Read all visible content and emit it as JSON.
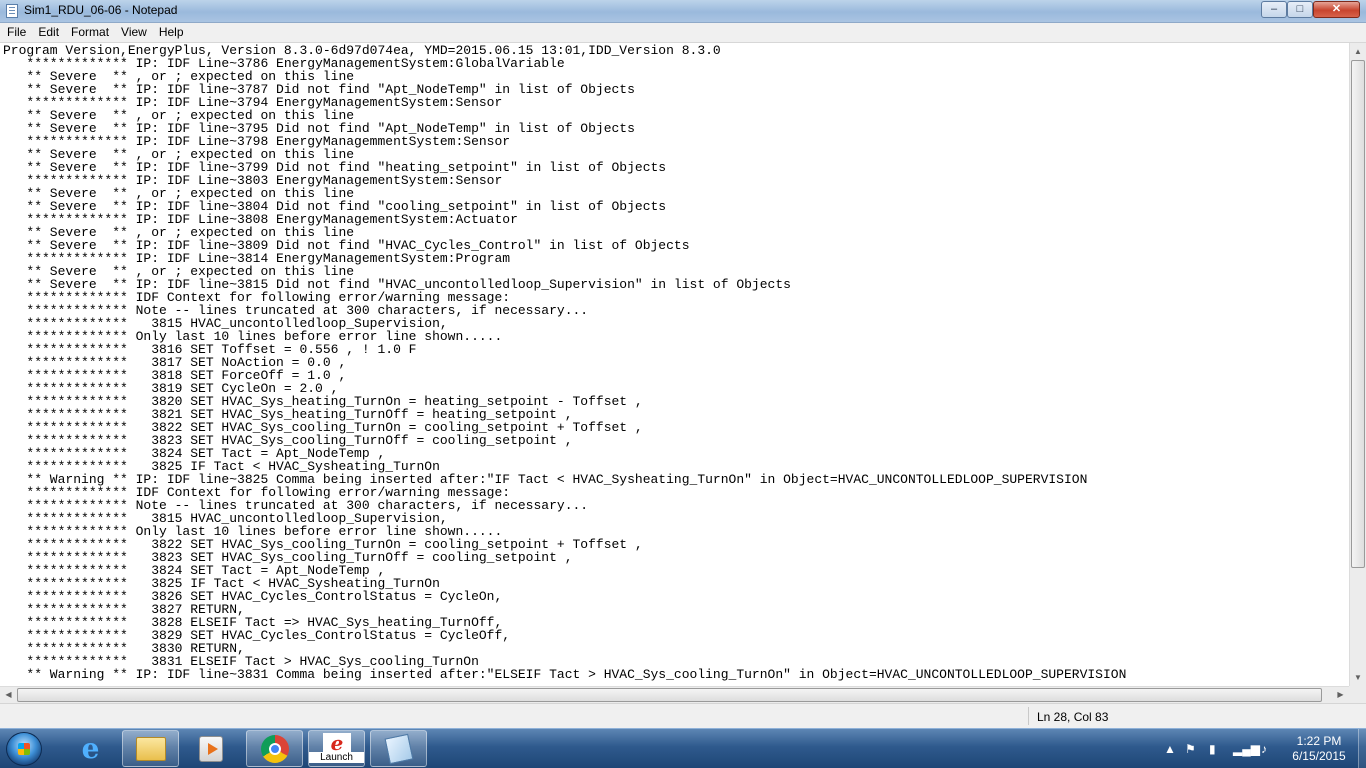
{
  "window": {
    "title": "Sim1_RDU_06-06 - Notepad"
  },
  "menu": [
    "File",
    "Edit",
    "Format",
    "View",
    "Help"
  ],
  "editor": {
    "lines": [
      "Program Version,EnergyPlus, Version 8.3.0-6d97d074ea, YMD=2015.06.15 13:01,IDD_Version 8.3.0",
      "   ************* IP: IDF Line~3786 EnergyManagementSystem:GlobalVariable",
      "   ** Severe  ** , or ; expected on this line",
      "   ** Severe  ** IP: IDF line~3787 Did not find \"Apt_NodeTemp\" in list of Objects",
      "   ************* IP: IDF Line~3794 EnergyManagementSystem:Sensor",
      "   ** Severe  ** , or ; expected on this line",
      "   ** Severe  ** IP: IDF line~3795 Did not find \"Apt_NodeTemp\" in list of Objects",
      "   ************* IP: IDF Line~3798 EnergyManagemmentSystem:Sensor",
      "   ** Severe  ** , or ; expected on this line",
      "   ** Severe  ** IP: IDF line~3799 Did not find \"heating_setpoint\" in list of Objects",
      "   ************* IP: IDF Line~3803 EnergyManagementSystem:Sensor",
      "   ** Severe  ** , or ; expected on this line",
      "   ** Severe  ** IP: IDF line~3804 Did not find \"cooling_setpoint\" in list of Objects",
      "   ************* IP: IDF Line~3808 EnergyManagementSystem:Actuator",
      "   ** Severe  ** , or ; expected on this line",
      "   ** Severe  ** IP: IDF line~3809 Did not find \"HVAC_Cycles_Control\" in list of Objects",
      "   ************* IP: IDF Line~3814 EnergyManagementSystem:Program",
      "   ** Severe  ** , or ; expected on this line",
      "   ** Severe  ** IP: IDF line~3815 Did not find \"HVAC_uncontolledloop_Supervision\" in list of Objects",
      "   ************* IDF Context for following error/warning message:",
      "   ************* Note -- lines truncated at 300 characters, if necessary...",
      "   *************   3815 HVAC_uncontolledloop_Supervision,",
      "   ************* Only last 10 lines before error line shown.....",
      "   *************   3816 SET Toffset = 0.556 , ! 1.0 F",
      "   *************   3817 SET NoAction = 0.0 ,",
      "   *************   3818 SET ForceOff = 1.0 ,",
      "   *************   3819 SET CycleOn = 2.0 ,",
      "   *************   3820 SET HVAC_Sys_heating_TurnOn = heating_setpoint - Toffset ,",
      "   *************   3821 SET HVAC_Sys_heating_TurnOff = heating_setpoint ,",
      "   *************   3822 SET HVAC_Sys_cooling_TurnOn = cooling_setpoint + Toffset ,",
      "   *************   3823 SET HVAC_Sys_cooling_TurnOff = cooling_setpoint ,",
      "   *************   3824 SET Tact = Apt_NodeTemp ,",
      "   *************   3825 IF Tact < HVAC_Sysheating_TurnOn",
      "   ** Warning ** IP: IDF line~3825 Comma being inserted after:\"IF Tact < HVAC_Sysheating_TurnOn\" in Object=HVAC_UNCONTOLLEDLOOP_SUPERVISION",
      "   ************* IDF Context for following error/warning message:",
      "   ************* Note -- lines truncated at 300 characters, if necessary...",
      "   *************   3815 HVAC_uncontolledloop_Supervision,",
      "   ************* Only last 10 lines before error line shown.....",
      "   *************   3822 SET HVAC_Sys_cooling_TurnOn = cooling_setpoint + Toffset ,",
      "   *************   3823 SET HVAC_Sys_cooling_TurnOff = cooling_setpoint ,",
      "   *************   3824 SET Tact = Apt_NodeTemp ,",
      "   *************   3825 IF Tact < HVAC_Sysheating_TurnOn",
      "   *************   3826 SET HVAC_Cycles_ControlStatus = CycleOn,",
      "   *************   3827 RETURN,",
      "   *************   3828 ELSEIF Tact => HVAC_Sys_heating_TurnOff,",
      "   *************   3829 SET HVAC_Cycles_ControlStatus = CycleOff,",
      "   *************   3830 RETURN,",
      "   *************   3831 ELSEIF Tact > HVAC_Sys_cooling_TurnOn",
      "   ** Warning ** IP: IDF line~3831 Comma being inserted after:\"ELSEIF Tact > HVAC_Sys_cooling_TurnOn\" in Object=HVAC_UNCONTOLLEDLOOP_SUPERVISION"
    ]
  },
  "status": {
    "position": "Ln 28, Col 83"
  },
  "taskbar": {
    "pinned": [
      {
        "name": "internet-explorer",
        "icon": "ie-icon"
      },
      {
        "name": "windows-explorer",
        "icon": "folder-icon"
      },
      {
        "name": "media-player",
        "icon": "media-player-icon"
      },
      {
        "name": "chrome",
        "icon": "chrome-icon"
      },
      {
        "name": "launch",
        "icon": "launch-icon",
        "label": "Launch"
      },
      {
        "name": "notepad",
        "icon": "notepad-icon"
      }
    ],
    "clock": {
      "time": "1:22 PM",
      "date": "6/15/2015"
    }
  },
  "colors": {
    "titlebar": "#9ab9dc",
    "taskbar": "#2f5a8d",
    "close_button": "#c8452f"
  }
}
